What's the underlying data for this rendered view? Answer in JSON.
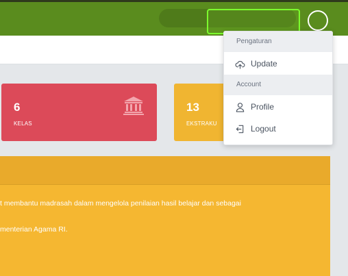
{
  "colors": {
    "topbar": "#5a8c1e",
    "card_red": "#dc4a59",
    "card_yellow": "#f0b531",
    "panel": "#f5b731",
    "highlight": "#7cff2e"
  },
  "cards": [
    {
      "value": "6",
      "label": "KELAS",
      "icon": "bank-icon"
    },
    {
      "value": "13",
      "label": "EKSTRAKU"
    }
  ],
  "panel": {
    "line1": "t membantu madrasah dalam mengelola penilaian hasil belajar dan sebagai",
    "line2": "menterian Agama RI."
  },
  "dropdown": {
    "section1": "Pengaturan",
    "update": "Update",
    "update_icon": "cloud-upload-icon",
    "section2": "Account",
    "profile": "Profile",
    "profile_icon": "user-icon",
    "logout": "Logout",
    "logout_icon": "logout-icon"
  }
}
